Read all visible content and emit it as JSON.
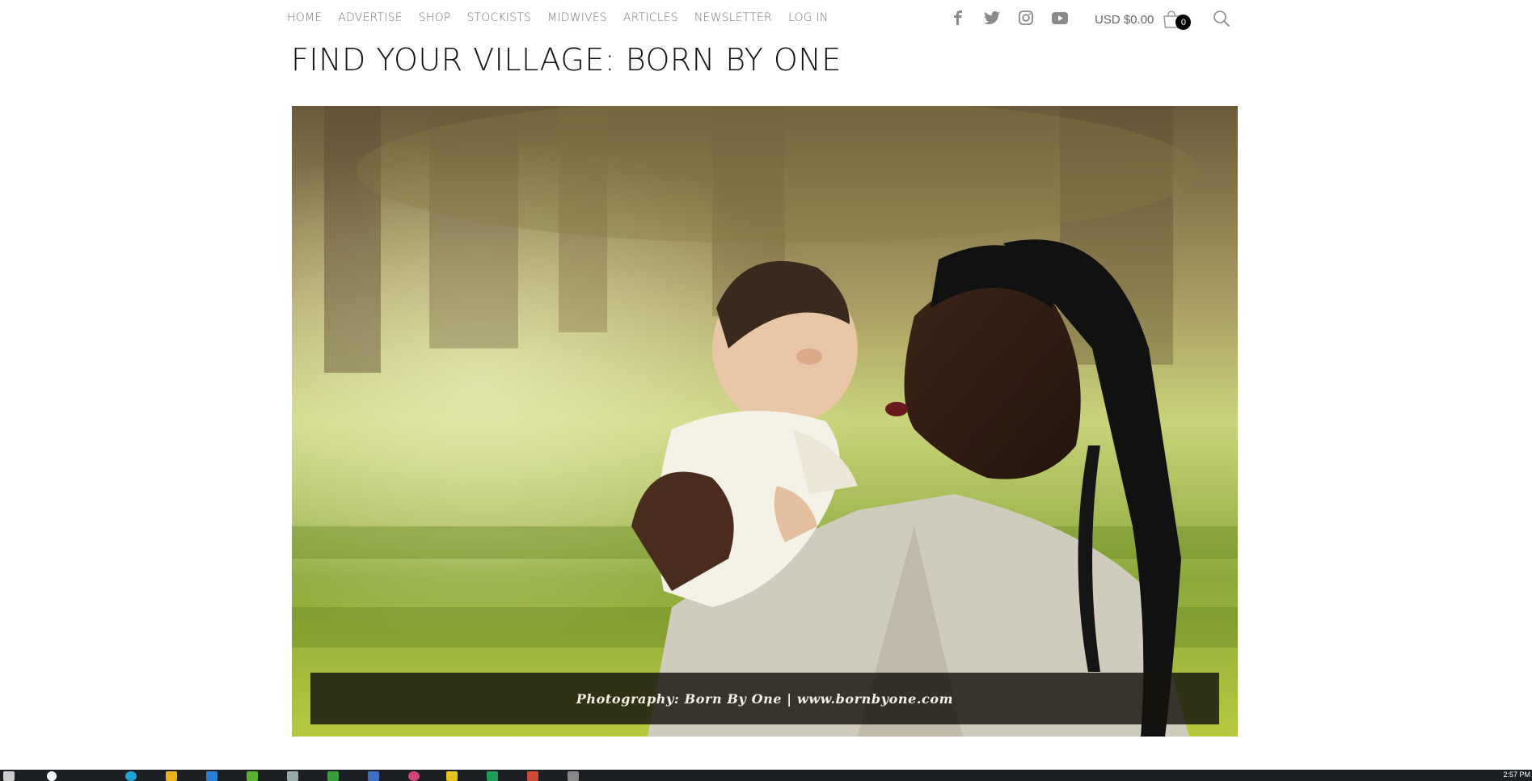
{
  "nav": {
    "items": [
      "HOME",
      "ADVERTISE",
      "SHOP",
      "STOCKISTS",
      "MIDWIVES",
      "ARTICLES",
      "NEWSLETTER",
      "LOG IN"
    ]
  },
  "social": [
    "facebook-icon",
    "twitter-icon",
    "instagram-icon",
    "youtube-icon"
  ],
  "cart": {
    "total": "USD $0.00",
    "count": "0"
  },
  "page": {
    "title": "FIND YOUR VILLAGE: BORN BY ONE"
  },
  "hero": {
    "caption": "Photography: Born By One | www.bornbyone.com"
  },
  "taskbar": {
    "clock": "2:57 PM"
  },
  "colors": {
    "text": "#777777",
    "title": "#111111",
    "caption_bg": "#14120c",
    "taskbar": "#1c1f24"
  }
}
